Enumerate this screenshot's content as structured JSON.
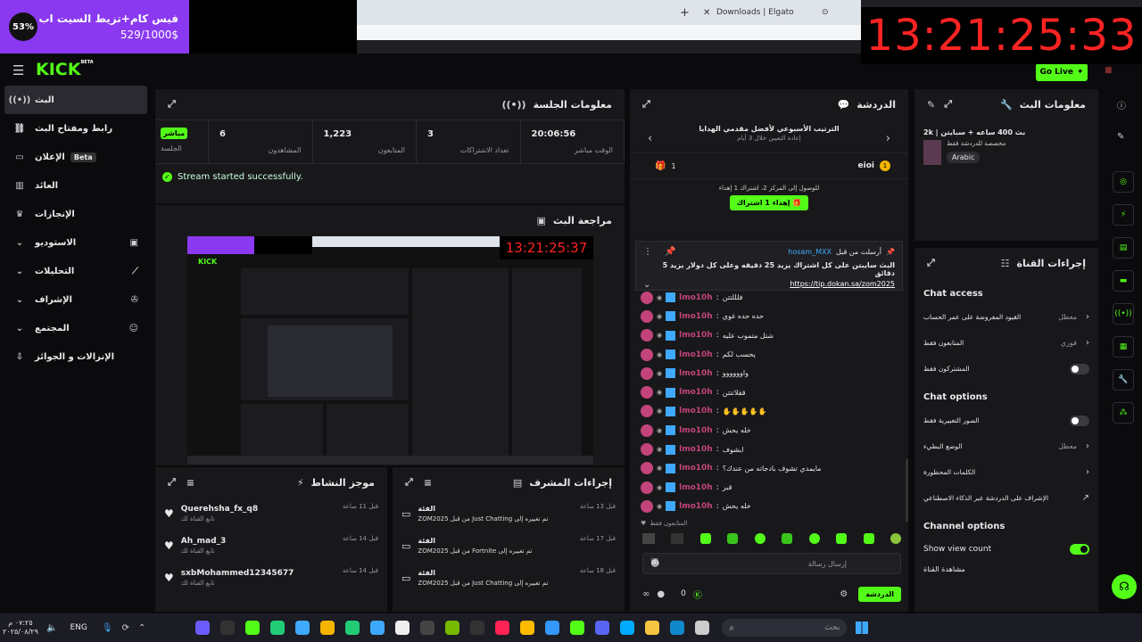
{
  "overlay": {
    "badge": "53%",
    "line1": "فيس كام+تزيط السيت اب",
    "line2": "529/1000$",
    "clock": "13:21:25:33"
  },
  "browser": {
    "tab_label": "Downloads | Elgato"
  },
  "header": {
    "logo": "KICK",
    "logo_sup": "BETA",
    "go_live": "Go Live"
  },
  "sidebar": {
    "items": [
      {
        "label": "البث",
        "icon": "broadcast-icon",
        "active": true
      },
      {
        "label": "رابط ومفتاح البث",
        "icon": "link-icon"
      },
      {
        "label": "الإعلان",
        "badge": "Beta",
        "icon": "ad-icon"
      },
      {
        "label": "العائد",
        "icon": "revenue-icon"
      },
      {
        "label": "الإنجازات",
        "icon": "trophy-icon"
      },
      {
        "label": "الاستوديو",
        "icon": "studio-icon",
        "chevron": true
      },
      {
        "label": "التحليلات",
        "icon": "analytics-icon",
        "chevron": true
      },
      {
        "label": "الإشراف",
        "icon": "moderation-icon",
        "chevron": true
      },
      {
        "label": "المجتمع",
        "icon": "community-icon",
        "chevron": true
      },
      {
        "label": "الإنزالات و الجوائز",
        "icon": "drops-icon"
      }
    ]
  },
  "session": {
    "title": "معلومات الجلسة",
    "live_chip": "مباشر",
    "live_label": "الجلسة",
    "stats": [
      {
        "value": "6",
        "label": "المشاهدون"
      },
      {
        "value": "1,223",
        "label": "المتابعون"
      },
      {
        "value": "3",
        "label": "تعداد الاشتراكات"
      },
      {
        "value": "20:06:56",
        "label": "الوقت مباشر"
      }
    ],
    "status": "Stream started successfully."
  },
  "preview": {
    "title": "مراجعة البث",
    "clock": "13:21:25:37"
  },
  "activity": {
    "title": "موجز النشاط",
    "items": [
      {
        "name": "Querehsha_fx_q8",
        "sub": "تابع القناة لك",
        "time": "قبل 11 ساعة"
      },
      {
        "name": "Ah_mad_3",
        "sub": "تابع القناة لك",
        "time": "قبل 14 ساعة"
      },
      {
        "name": "sxbMohammed12345677",
        "sub": "تابع القناة لك",
        "time": "قبل 14 ساعة"
      }
    ]
  },
  "modactions": {
    "title": "إجراءات المشرف",
    "items": [
      {
        "title": "الفئة",
        "detail": "تم تغييره إلى Just Chatting من قبل ZOM2025",
        "time": "قبل 13 ساعة"
      },
      {
        "title": "الفئة",
        "detail": "تم تغييره إلى Fortnite من قبل ZOM2025",
        "time": "قبل 17 ساعة"
      },
      {
        "title": "الفئة",
        "detail": "تم تغييره إلى Just Chatting من قبل ZOM2025",
        "time": "قبل 18 ساعة"
      }
    ]
  },
  "chat": {
    "title": "الدردشة",
    "leader_title": "الترتيب الأسبوعي لأفضل مقدمي الهدايا",
    "leader_sub": "إعادة التعيين خلال 3 أيام",
    "leader_name": "eioi",
    "leader_rank": "1",
    "leader_count": "1",
    "goal_text": "للوصول إلى المركز 2، اشتراك 1 إهداء",
    "gift_button": "إهداء 1 اشتراك",
    "pinned_by": "أرسلت من قبل",
    "pinned_user": "hosam_MXX",
    "pinned_text": "البث سايبتن على كل اشتراك يزيد 25 دقيقه وعلى كل دولار يزيد 5 دقائق",
    "pinned_link": "https://tip.dokan.sa/zom2025",
    "user": "lmo10h",
    "messages": [
      "فلللتتن",
      "حده حده غوي",
      "شتل متموب عليه",
      "يحسب لكم",
      "واوووووو",
      "ققلاتتتن",
      "✋✋✋✋✋",
      "خله يحش",
      "ابشوف",
      "مايمدي تشوف بادجاته من عندك؟",
      "قبر",
      "خله يحش"
    ],
    "followers_only": "المتابعون فقط",
    "input_placeholder": "إرسال رسالة",
    "points": "0",
    "send_button": "الدردشة"
  },
  "streaminfo": {
    "title": "معلومات البث",
    "stream_title": "بث 400 ساعه + سبايتن | 2k",
    "category": "مخصصة للدردشة فقط",
    "language": "Arabic"
  },
  "channel": {
    "title": "إجراءات القناة",
    "chat_access": "Chat access",
    "access_rows": [
      {
        "label": "القيود المفروضة على عمر الحساب",
        "value": "معطل",
        "control": "chevron"
      },
      {
        "label": "المتابعون فقط",
        "value": "فوري",
        "control": "chevron"
      },
      {
        "label": "المشتركون فقط",
        "value": "",
        "control": "toggle-off"
      }
    ],
    "chat_options": "Chat options",
    "option_rows": [
      {
        "label": "الصور التعبيرية فقط",
        "value": "",
        "control": "toggle-off"
      },
      {
        "label": "الوضع البطيء",
        "value": "معطل",
        "control": "chevron"
      },
      {
        "label": "الكلمات المحظورة",
        "value": "",
        "control": "chevron"
      },
      {
        "label": "الإشراف على الدردشة عبر الذكاء الاصطناعي",
        "value": "",
        "control": "external"
      }
    ],
    "channel_options": "Channel options",
    "show_view_count": "Show view count",
    "watch_channel": "مشاهدة القناة"
  },
  "taskbar": {
    "time": "٠٧:٢٥ م",
    "date": "٢٠٢٥/٠٨/٢٩",
    "lang": "ENG",
    "search": "بحث"
  },
  "colors": {
    "accent": "#53fc18",
    "panel": "#18181b",
    "bg": "#0b0b0d"
  }
}
